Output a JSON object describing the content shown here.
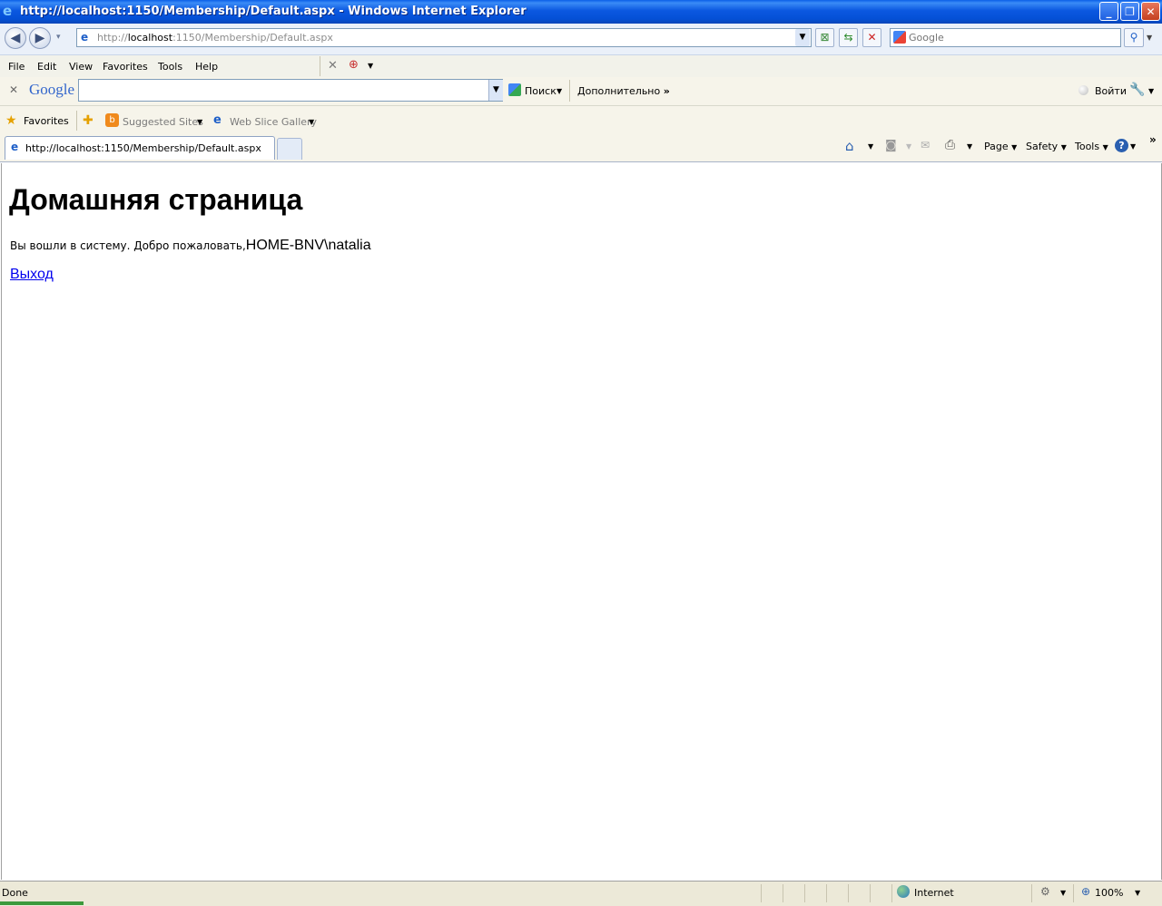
{
  "window": {
    "title": "http://localhost:1150/Membership/Default.aspx - Windows Internet Explorer",
    "minimize": "_",
    "restore": "❐",
    "close": "✕"
  },
  "address": {
    "prefix": "http://",
    "host": "localhost",
    "rest": ":1150/Membership/Default.aspx"
  },
  "search": {
    "placeholder": "Google"
  },
  "menu": {
    "items": [
      "File",
      "Edit",
      "View",
      "Favorites",
      "Tools",
      "Help"
    ]
  },
  "google_toolbar": {
    "logo": "Google",
    "search_button": "Поиск",
    "more": "Дополнительно",
    "signin": "Войти"
  },
  "favorites_bar": {
    "favorites": "Favorites",
    "suggested": "Suggested Sites",
    "webslice": "Web Slice Gallery"
  },
  "tabs": {
    "active_title": "http://localhost:1150/Membership/Default.aspx"
  },
  "command_bar": {
    "page": "Page",
    "safety": "Safety",
    "tools": "Tools"
  },
  "page": {
    "heading": "Домашняя страница",
    "welcome_text": "Вы вошли в систему. Добро пожаловать,",
    "username": "HOME-BNV\\natalia",
    "logout_link": "Выход"
  },
  "statusbar": {
    "status": "Done",
    "zone": "Internet",
    "zoom": "100%"
  },
  "colors": {
    "titlebar": "#0a5fe8",
    "link": "#0000ee",
    "chrome": "#f6f4ea"
  }
}
